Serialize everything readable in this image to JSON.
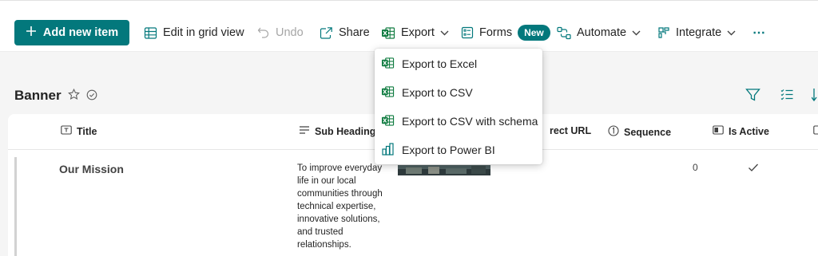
{
  "toolbar": {
    "add_new_item": "Add new item",
    "edit_grid": "Edit in grid view",
    "undo": "Undo",
    "share": "Share",
    "export": "Export",
    "forms": "Forms",
    "forms_badge": "New",
    "automate": "Automate",
    "integrate": "Integrate",
    "more": "⋯"
  },
  "list": {
    "title": "Banner",
    "columns": [
      "Title",
      "Sub Heading",
      "rect URL",
      "Sequence",
      "Is Active"
    ],
    "rows": [
      {
        "title": "Our Mission",
        "sub_heading": "To improve everyday life in our local communities through technical expertise, innovative solutions, and trusted relationships.",
        "sequence": "0",
        "is_active": true
      }
    ]
  },
  "export_menu": {
    "items": [
      {
        "label": "Export to Excel",
        "icon": "excel-icon"
      },
      {
        "label": "Export to CSV",
        "icon": "excel-icon"
      },
      {
        "label": "Export to CSV with schema",
        "icon": "excel-icon"
      },
      {
        "label": "Export to Power BI",
        "icon": "powerbi-icon"
      }
    ]
  },
  "colors": {
    "accent": "#03787c",
    "icon_green": "#107c41",
    "icon_teal": "#03787c"
  }
}
